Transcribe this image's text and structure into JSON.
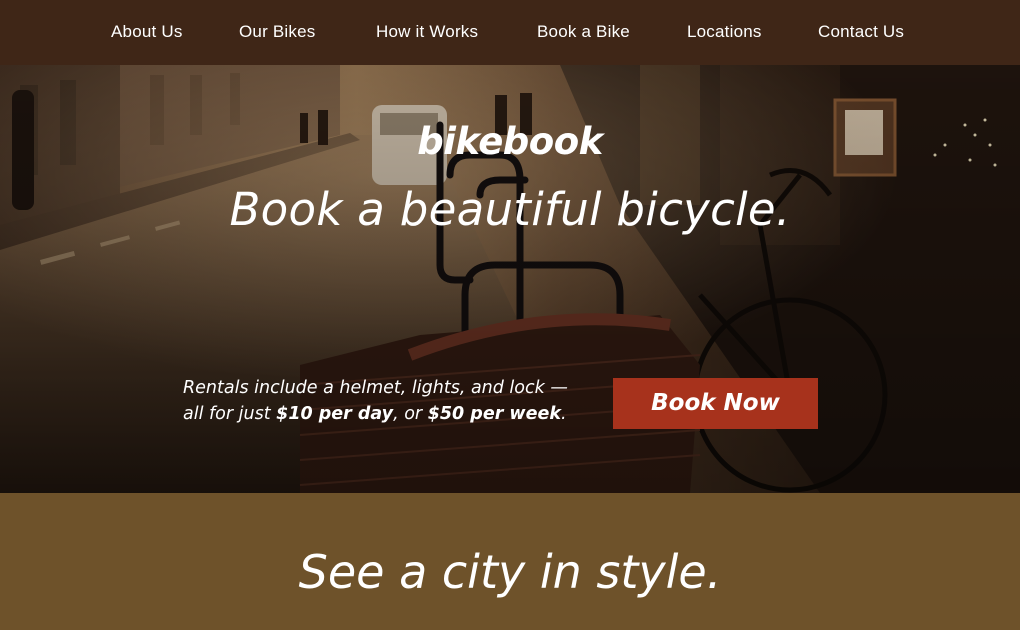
{
  "nav": {
    "items": [
      {
        "label": "About Us"
      },
      {
        "label": "Our Bikes"
      },
      {
        "label": "How it Works"
      },
      {
        "label": "Book a Bike"
      },
      {
        "label": "Locations"
      },
      {
        "label": "Contact Us"
      }
    ]
  },
  "hero": {
    "logo": "bikebook",
    "tagline": "Book a beautiful bicycle.",
    "rental_line1": "Rentals include a helmet, lights, and lock —",
    "rental_prefix": "all for just ",
    "price_day": "$10 per day",
    "rental_mid": ", or ",
    "price_week": "$50 per week",
    "rental_suffix": ".",
    "book_button": "Book Now"
  },
  "band": {
    "title": "See a city in style."
  },
  "colors": {
    "nav_bg": "#3f2617",
    "button_bg": "#a7321c",
    "band_bg": "#6e522a"
  }
}
